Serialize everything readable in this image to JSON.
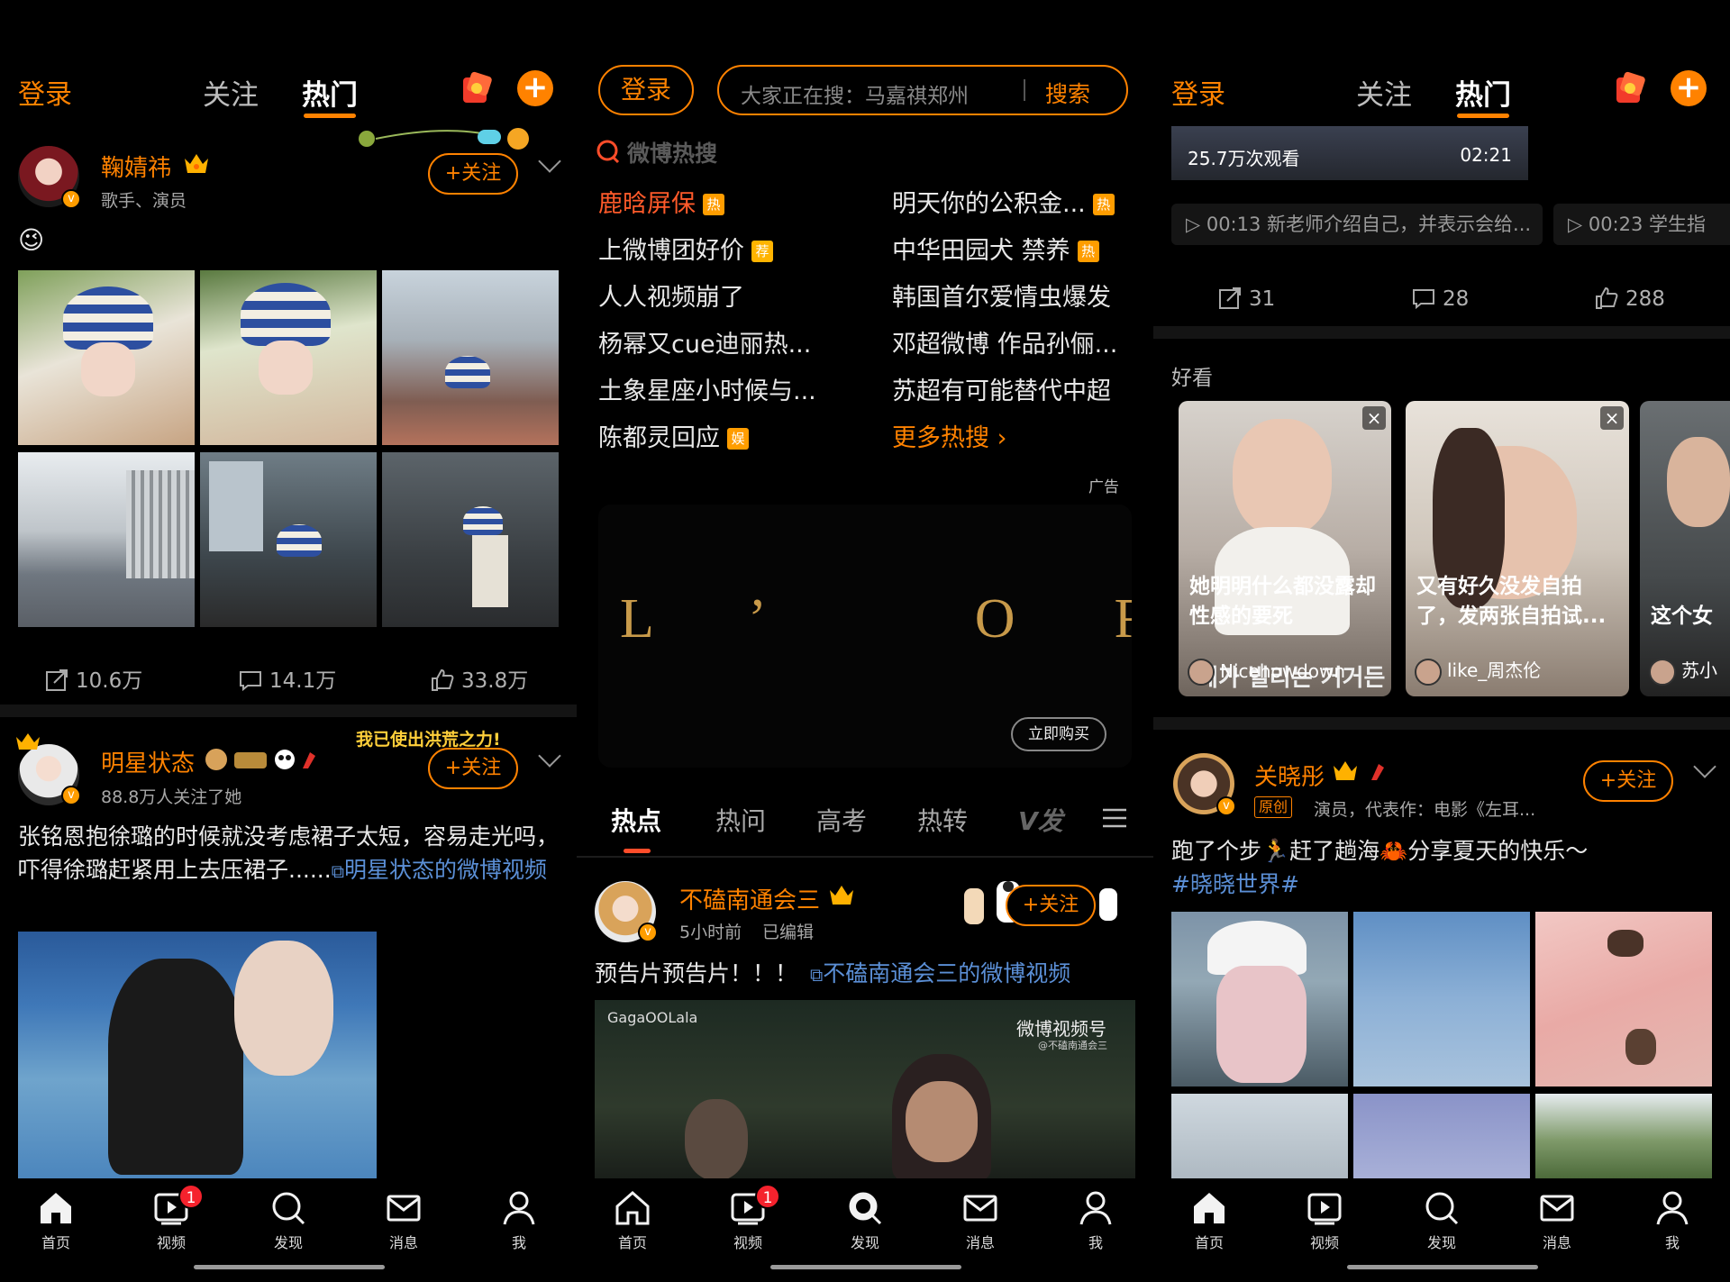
{
  "left": {
    "topbar": {
      "login": "登录",
      "tab_follow": "关注",
      "tab_hot": "热门"
    },
    "post1": {
      "username": "鞠婧祎",
      "subtitle": "歌手、演员",
      "follow": "+关注",
      "emoji": "😉",
      "stats": {
        "repost": "10.6万",
        "comment": "14.1万",
        "like": "33.8万"
      }
    },
    "post2": {
      "username": "明星状态",
      "subtitle": "88.8万人关注了她",
      "follow": "+关注",
      "banner": "我已使出洪荒之力!",
      "text": "张铭恩抱徐璐的时候就没考虑裙子太短，容易走光吗，吓得徐璐赶紧用上去压裙子......",
      "link": "明星状态的微博视频"
    },
    "nav": [
      "首页",
      "视频",
      "发现",
      "消息",
      "我"
    ],
    "nav_badge": "1"
  },
  "middle": {
    "login": "登录",
    "search_placeholder": "大家正在搜：马嘉祺郑州",
    "search_button": "搜索",
    "hot_search_logo": "微博热搜",
    "hot_searches": [
      {
        "text": "鹿晗屏保",
        "tag": "热"
      },
      {
        "text": "明天你的公积金...",
        "tag": "热"
      },
      {
        "text": "上微博团好价",
        "tag": "荐"
      },
      {
        "text": "中华田园犬 禁养",
        "tag": "热"
      },
      {
        "text": "人人视频崩了",
        "tag": ""
      },
      {
        "text": "韩国首尔爱情虫爆发",
        "tag": ""
      },
      {
        "text": "杨幂又cue迪丽热...",
        "tag": ""
      },
      {
        "text": "邓超微博 作品孙俪...",
        "tag": ""
      },
      {
        "text": "土象星座小时候与...",
        "tag": ""
      },
      {
        "text": "苏超有可能替代中超",
        "tag": ""
      },
      {
        "text": "陈都灵回应",
        "tag": "娱"
      }
    ],
    "more_hot": "更多热搜",
    "ad_label": "广告",
    "ad_logo": "L’ OR ÉA",
    "ad_button": "立即购买",
    "subtabs": [
      "热点",
      "热问",
      "高考",
      "热转",
      "V发"
    ],
    "post": {
      "username": "不磕南通会三",
      "time": "5小时前",
      "edited": "已编辑",
      "follow": "+关注",
      "text": "预告片预告片！！！",
      "link": "不磕南通会三的微博视频",
      "video_watermark": "GagaOOLala",
      "video_channel": "微博视频号",
      "video_channel_sub": "@不磕南通会三"
    },
    "nav": [
      "首页",
      "视频",
      "发现",
      "消息",
      "我"
    ],
    "nav_badge": "1"
  },
  "right": {
    "topbar": {
      "login": "登录",
      "tab_follow": "关注",
      "tab_hot": "热门"
    },
    "video": {
      "views": "25.7万次观看",
      "duration": "02:21"
    },
    "suggestions": [
      "00:13 新老师介绍自己，并表示会给...",
      "00:23 学生指"
    ],
    "stats": {
      "repost": "31",
      "comment": "28",
      "like": "288"
    },
    "section_title": "好看",
    "cards": [
      {
        "title": "她明明什么都没露却性感的要死",
        "user": "Nicehowdown",
        "overlay": "데가 빌리는 거거든"
      },
      {
        "title": "又有好久没发自拍了，发两张自拍试...",
        "user": "like_周杰伦"
      },
      {
        "title": "这个女",
        "user": "苏小"
      }
    ],
    "post": {
      "username": "关晓彤",
      "badge": "原创",
      "subtitle": "演员，代表作：电影《左耳...",
      "follow": "+关注",
      "text": "跑了个步🏃赶了趟海🦀分享夏天的快乐～",
      "hashtag": "#晓晓世界#"
    },
    "nav": [
      "首页",
      "视频",
      "发现",
      "消息",
      "我"
    ]
  },
  "colors": {
    "accent": "#ff8200",
    "link": "#5b8fd6",
    "badge": "#f5222d"
  }
}
